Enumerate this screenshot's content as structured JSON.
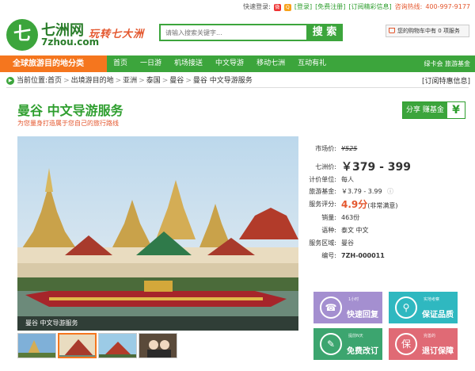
{
  "topbar": {
    "login_label": "快速登录:",
    "register": "[登录]",
    "free_reg": "[免费注册]",
    "subscribe": "[订阅精彩信息]",
    "hotline_label": "咨询热线:",
    "hotline": "400-997-9177"
  },
  "header": {
    "logo_glyph": "七",
    "logo_cn": "七洲网",
    "logo_en": "7zhou.com",
    "slogan": "玩转七大洲",
    "search_placeholder": "请输入搜索关键字...",
    "search_button": "搜 索",
    "cart": "您的购物车中有 0 项服务"
  },
  "nav": {
    "category": "全球旅游目的地分类",
    "items": [
      "首页",
      "一日游",
      "机场接送",
      "中文导游",
      "移动七洲",
      "互动有礼"
    ],
    "right": "绿卡会 旅游基金"
  },
  "breadcrumb": {
    "label": "当前位置:",
    "items": [
      "首页",
      "出境游目的地",
      "亚洲",
      "泰国",
      "曼谷",
      "曼谷 中文导游服务"
    ],
    "subscribe": "[订阅特惠信息]"
  },
  "product": {
    "title": "曼谷 中文导游服务",
    "subtitle": "为您量身打造属于您自己的旅行路线",
    "share": "分享 赚基金",
    "share_icon": "¥",
    "photo_caption": "曼谷 中文导游服务",
    "market_price_label": "市场价:",
    "market_price": "¥525",
    "price_label": "七洲价:",
    "price": "￥379 - 399",
    "unit_label": "计价单位:",
    "unit": "每人",
    "fund_label": "旅游基金:",
    "fund": "￥3.79 - 3.99",
    "rating_label": "服务评分:",
    "rating": "4.9分",
    "rating_note": "(非常满意)",
    "sold_label": "销量:",
    "sold": "463份",
    "lang_label": "语种:",
    "lang": "泰文 中文",
    "area_label": "服务区域:",
    "area": "曼谷",
    "code_label": "编号:",
    "code": "7ZH-000011"
  },
  "tiles": [
    {
      "small": "1小时",
      "label": "快速回复",
      "color": "#a48fd0",
      "icon": "phone-icon",
      "glyph": "☎"
    },
    {
      "small": "实地考察",
      "label": "保证品质",
      "color": "#2fb8c0",
      "icon": "magnifier-icon",
      "glyph": "⚲"
    },
    {
      "small": "提前N天",
      "label": "免费改订",
      "color": "#3ca56f",
      "icon": "quill-icon",
      "glyph": "✎"
    },
    {
      "small": "完善的",
      "label": "退订保障",
      "color": "#e06a75",
      "icon": "shield-icon",
      "glyph": "保"
    }
  ]
}
